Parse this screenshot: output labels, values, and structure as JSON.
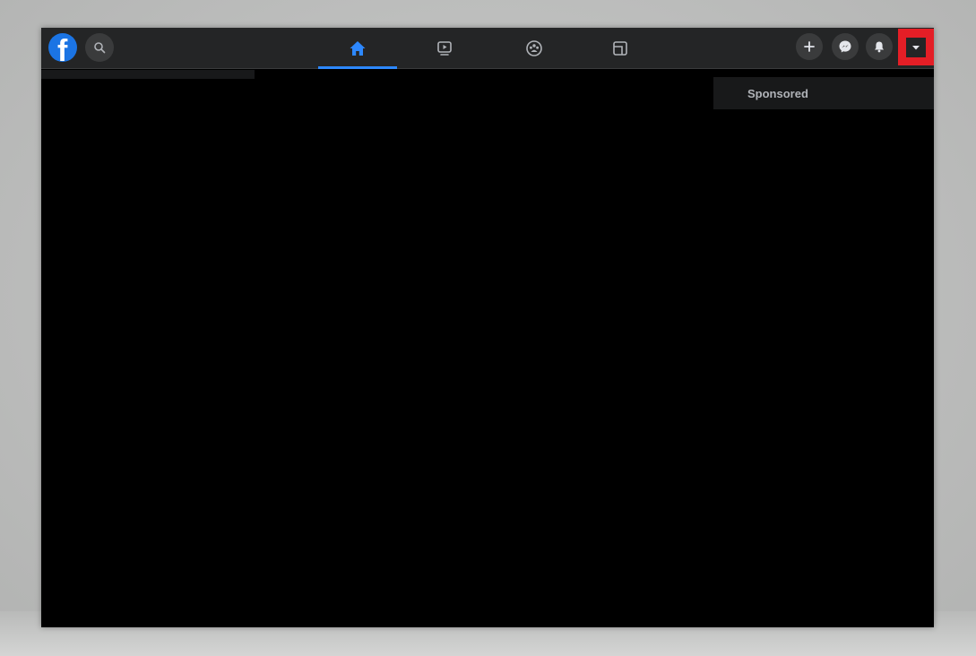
{
  "nav": {
    "logo_letter": "f",
    "tabs": [
      {
        "name": "home",
        "icon": "home-icon",
        "active": true
      },
      {
        "name": "watch",
        "icon": "video-play-icon",
        "active": false
      },
      {
        "name": "groups",
        "icon": "groups-icon",
        "active": false
      },
      {
        "name": "gaming",
        "icon": "gaming-icon",
        "active": false
      }
    ],
    "actions": [
      {
        "name": "create",
        "icon": "plus-icon"
      },
      {
        "name": "messenger",
        "icon": "messenger-icon"
      },
      {
        "name": "notifications",
        "icon": "bell-icon"
      },
      {
        "name": "account",
        "icon": "caret-down-icon",
        "highlighted": true
      }
    ]
  },
  "right_rail": {
    "sponsored_label": "Sponsored"
  },
  "colors": {
    "topbar": "#242526",
    "panel": "#18191a",
    "content_bg": "#000000",
    "accent": "#2d88ff",
    "logo": "#1b74e4",
    "highlight_box": "#e41e26",
    "icon_inactive": "#b0b3b8",
    "secondary_text": "#b0b3b8"
  }
}
